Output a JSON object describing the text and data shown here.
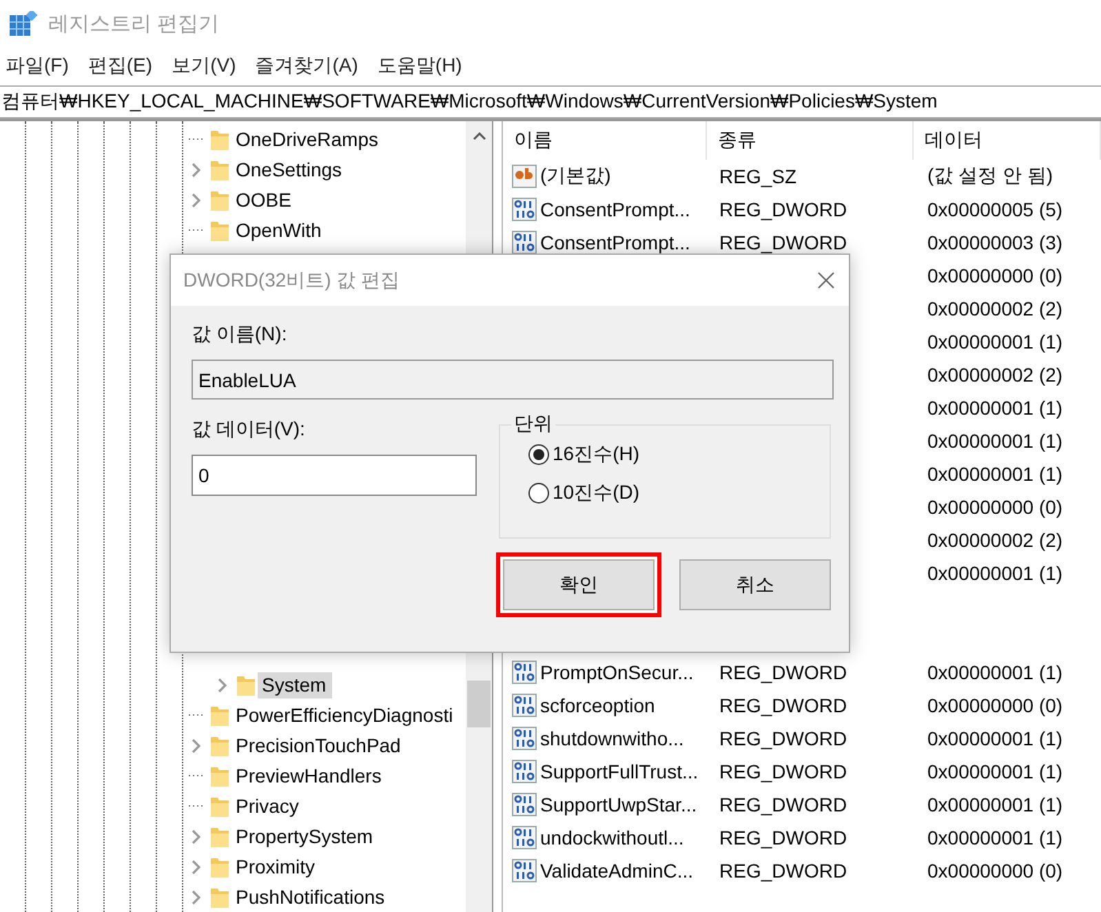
{
  "window": {
    "title": "레지스트리 편집기"
  },
  "menu": [
    "파일(F)",
    "편집(E)",
    "보기(V)",
    "즐겨찾기(A)",
    "도움말(H)"
  ],
  "address": "컴퓨터₩HKEY_LOCAL_MACHINE₩SOFTWARE₩Microsoft₩Windows₩CurrentVersion₩Policies₩System",
  "tree": {
    "items": [
      {
        "name": "OneDriveRamps",
        "expandable": false,
        "selected": false
      },
      {
        "name": "OneSettings",
        "expandable": true,
        "selected": false
      },
      {
        "name": "OOBE",
        "expandable": true,
        "selected": false
      },
      {
        "name": "OpenWith",
        "expandable": false,
        "selected": false
      },
      {
        "kind": "covered",
        "children": [
          {
            "name": "System",
            "expandable": true,
            "selected": true
          }
        ]
      },
      {
        "name": "PowerEfficiencyDiagnosti",
        "expandable": false,
        "selected": false
      },
      {
        "name": "PrecisionTouchPad",
        "expandable": true,
        "selected": false
      },
      {
        "name": "PreviewHandlers",
        "expandable": false,
        "selected": false
      },
      {
        "name": "Privacy",
        "expandable": false,
        "selected": false
      },
      {
        "name": "PropertySystem",
        "expandable": true,
        "selected": false
      },
      {
        "name": "Proximity",
        "expandable": true,
        "selected": false
      },
      {
        "name": "PushNotifications",
        "expandable": true,
        "selected": false
      }
    ]
  },
  "list": {
    "columns": [
      "이름",
      "종류",
      "데이터"
    ],
    "rows": [
      {
        "kind": "string",
        "name": "(기본값)",
        "type": "REG_SZ",
        "data": "(값 설정 안 됨)"
      },
      {
        "kind": "dword",
        "name": "ConsentPrompt...",
        "type": "REG_DWORD",
        "data": "0x00000005 (5)"
      },
      {
        "kind": "dword",
        "name": "ConsentPrompt...",
        "type": "REG_DWORD",
        "data": "0x00000003 (3)"
      },
      {
        "kind": "dword",
        "data": "0x00000000 (0)"
      },
      {
        "kind": "dword",
        "data": "0x00000002 (2)"
      },
      {
        "kind": "dword",
        "data": "0x00000001 (1)"
      },
      {
        "kind": "dword",
        "data": "0x00000002 (2)"
      },
      {
        "kind": "dword",
        "data": "0x00000001 (1)"
      },
      {
        "kind": "dword",
        "data": "0x00000001 (1)"
      },
      {
        "kind": "dword",
        "data": "0x00000001 (1)"
      },
      {
        "kind": "dword",
        "data": "0x00000000 (0)"
      },
      {
        "kind": "dword",
        "data": "0x00000002 (2)"
      },
      {
        "kind": "dword",
        "data": "0x00000001 (1)"
      },
      {
        "kind": "covered"
      },
      {
        "kind": "covered"
      },
      {
        "kind": "dword",
        "name": "PromptOnSecur...",
        "type": "REG_DWORD",
        "data": "0x00000001 (1)"
      },
      {
        "kind": "dword",
        "name": "scforceoption",
        "type": "REG_DWORD",
        "data": "0x00000000 (0)"
      },
      {
        "kind": "dword",
        "name": "shutdownwitho...",
        "type": "REG_DWORD",
        "data": "0x00000001 (1)"
      },
      {
        "kind": "dword",
        "name": "SupportFullTrust...",
        "type": "REG_DWORD",
        "data": "0x00000001 (1)"
      },
      {
        "kind": "dword",
        "name": "SupportUwpStar...",
        "type": "REG_DWORD",
        "data": "0x00000001 (1)"
      },
      {
        "kind": "dword",
        "name": "undockwithoutl...",
        "type": "REG_DWORD",
        "data": "0x00000001 (1)"
      },
      {
        "kind": "dword",
        "name": "ValidateAdminC...",
        "type": "REG_DWORD",
        "data": "0x00000000 (0)"
      }
    ]
  },
  "dialog": {
    "title": "DWORD(32비트) 값 편집",
    "name_label": "값 이름(N):",
    "name_value": "EnableLUA",
    "data_label": "값 데이터(V):",
    "data_value": "0",
    "base_label": "단위",
    "bases": [
      {
        "label": "16진수(H)",
        "selected": true
      },
      {
        "label": "10진수(D)",
        "selected": false
      }
    ],
    "buttons": [
      {
        "label": "확인",
        "highlighted": true
      },
      {
        "label": "취소",
        "highlighted": false
      }
    ]
  }
}
